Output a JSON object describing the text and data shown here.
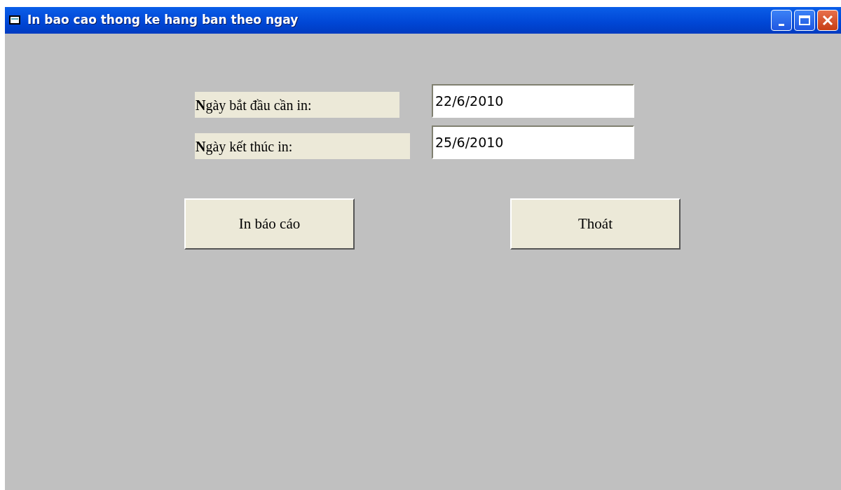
{
  "window": {
    "title": "In bao cao thong ke hang ban theo ngay"
  },
  "fields": [
    {
      "label": "**N**gày bắt đầu cần in:",
      "value": "22/6/2010"
    },
    {
      "label": "**N**gày kết thúc in:",
      "value": "25/6/2010"
    }
  ],
  "buttons": [
    "In báo cáo",
    "Thoát"
  ]
}
